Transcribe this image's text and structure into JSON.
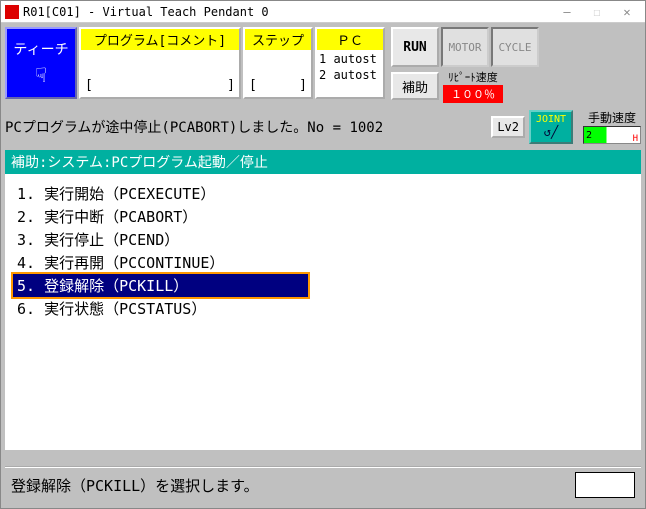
{
  "window_title": "R01[C01] - Virtual Teach Pendant 0",
  "teach_label": "ティーチ",
  "columns": {
    "program": {
      "header": "プログラム[コメント]",
      "left_bracket": "[",
      "right_bracket": "]"
    },
    "step": {
      "header": "ステップ",
      "left_bracket": "[",
      "right_bracket": "]"
    },
    "pc": {
      "header": "ＰＣ",
      "line1": "1 autost",
      "line2": "2 autost"
    }
  },
  "run_label": "RUN",
  "motor_label": "MOTOR",
  "cycle_label": "CYCLE",
  "aux_label": "補助",
  "repeat": {
    "label": "ﾘﾋﾟｰﾄ速度",
    "value": "１００％"
  },
  "manual": {
    "label": "手動速度",
    "value": "2"
  },
  "message": "PCプログラムが途中停止(PCABORT)しました。No = 1002",
  "lv_label": "Lv2",
  "joint_label": "JOINT",
  "menu": {
    "header": "補助:システム:PCプログラム起動／停止",
    "items": [
      "1.  実行開始（PCEXECUTE）",
      "2.  実行中断（PCABORT）",
      "3.  実行停止（PCEND）",
      "4.  実行再開（PCCONTINUE）",
      "5.  登録解除（PCKILL）",
      "6.  実行状態（PCSTATUS）"
    ],
    "selected_index": 4
  },
  "status_text": "登録解除（PCKILL）を選択します。"
}
